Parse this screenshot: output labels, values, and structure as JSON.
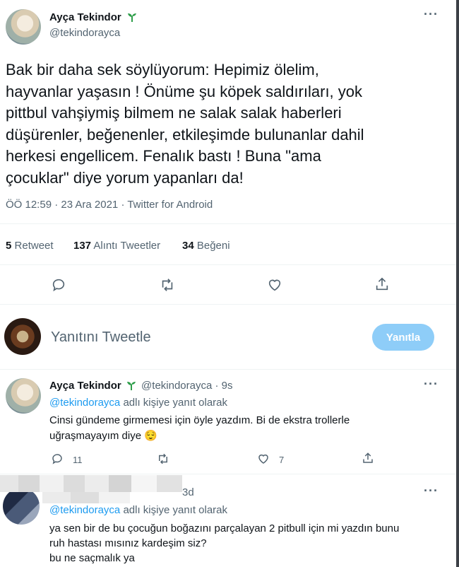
{
  "main_tweet": {
    "author_name": "Ayça Tekindor",
    "author_handle": "@tekindorayca",
    "text_lines": [
      "Bak bir daha sek söylüyorum: Hepimiz ölelim,",
      "hayvanlar yaşasın ! Önüme şu köpek saldırıları, yok",
      "pittbul vahşiymiş bilmem ne salak salak haberleri",
      "düşürenler, beğenenler, etkileşimde bulunanlar dahil",
      "herkesi engellicem. Fenalık bastı ! Buna \"ama",
      "çocuklar\" diye yorum yapanları da!"
    ],
    "meta": "ÖÖ 12:59 · 23 Ara 2021 · Twitter for Android",
    "stats": {
      "retweet_count": "5",
      "retweet_label": "Retweet",
      "quote_count": "137",
      "quote_label": "Alıntı Tweetler",
      "like_count": "34",
      "like_label": "Beğeni"
    }
  },
  "compose": {
    "placeholder": "Yanıtını Tweetle",
    "button_label": "Yanıtla"
  },
  "replies": [
    {
      "author_name": "Ayça Tekindor",
      "author_handle": "@tekindorayca",
      "time": "· 9s",
      "reply_to_handle": "@tekindorayca",
      "reply_to_suffix": "adlı kişiye yanıt olarak",
      "text_lines": [
        "Cinsi gündeme girmemesi için öyle yazdım. Bi de ekstra trollerle",
        "uğraşmayayım diye 😌"
      ],
      "reply_count": "11",
      "like_count": "7"
    },
    {
      "time": "3d",
      "reply_to_handle": "@tekindorayca",
      "reply_to_suffix": "adlı kişiye yanıt olarak",
      "text_lines": [
        "ya sen bir de bu çocuğun boğazını parçalayan 2 pitbull için mi yazdın bunu",
        "ruh hastası mısınız kardeşim siz?",
        "bu ne saçmalık ya"
      ]
    }
  ],
  "colors": {
    "accent": "#1d9bf0",
    "verified_sprout": "#2e9e4a",
    "reply_button_disabled": "#8ecdf8",
    "muted_text": "#536471"
  }
}
